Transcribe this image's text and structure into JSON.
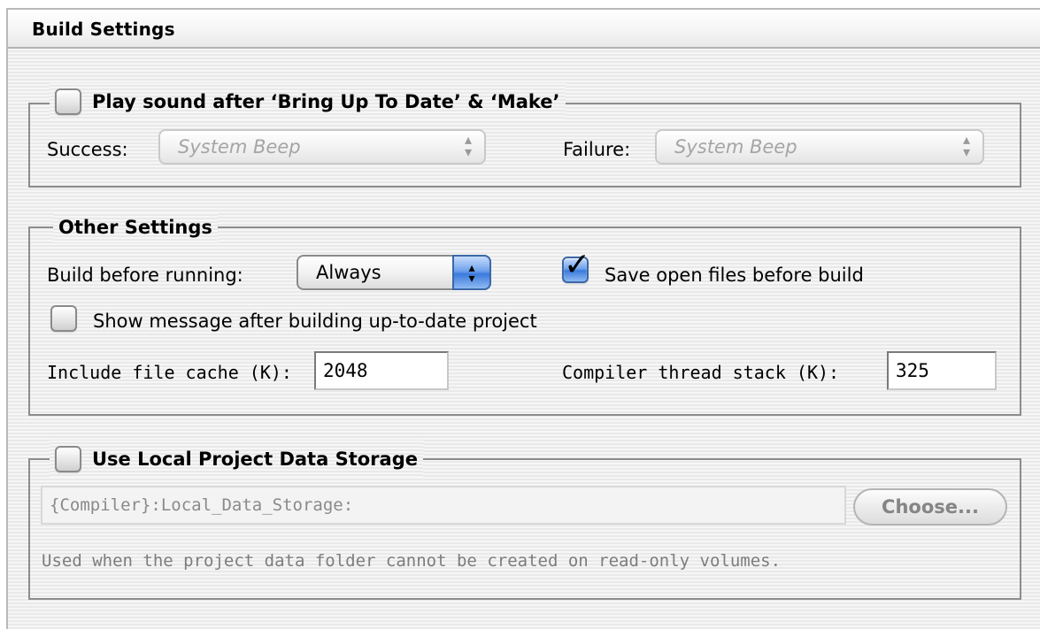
{
  "header": {
    "title": "Build Settings"
  },
  "sound_group": {
    "checkbox_label": "Play sound after ‘Bring Up To Date’ & ‘Make’",
    "checked": false,
    "success_label": "Success:",
    "success_value": "System Beep",
    "failure_label": "Failure:",
    "failure_value": "System Beep"
  },
  "other_group": {
    "title": "Other Settings",
    "build_before_label": "Build before running:",
    "build_before_value": "Always",
    "save_open_label": "Save open files before build",
    "save_open_checked": true,
    "show_message_label": "Show message after building up-to-date project",
    "show_message_checked": false,
    "include_cache_label": "Include file cache (K):",
    "include_cache_value": "2048",
    "thread_stack_label": "Compiler thread stack (K):",
    "thread_stack_value": "325"
  },
  "storage_group": {
    "checkbox_label": "Use Local Project Data Storage",
    "checked": false,
    "path_value": "{Compiler}:Local_Data_Storage:",
    "choose_label": "Choose...",
    "note": "Used when the project data folder cannot be created on read-only volumes."
  },
  "icons": {
    "popup_arrows": "up-down-arrows-icon",
    "check": "checkmark-icon"
  }
}
